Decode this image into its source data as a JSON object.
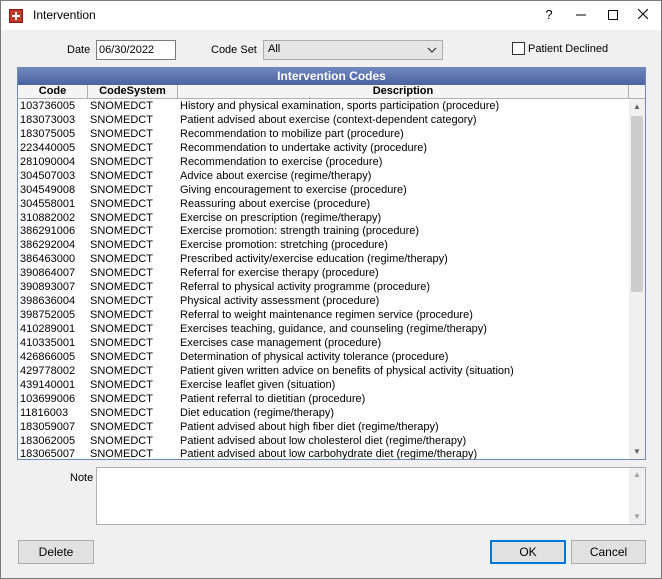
{
  "window": {
    "title": "Intervention"
  },
  "titlebar": {
    "help": "?",
    "minimize": "—",
    "maximize": "☐",
    "close": "✕"
  },
  "form": {
    "date_label": "Date",
    "date_value": "06/30/2022",
    "codeset_label": "Code Set",
    "codeset_value": "All",
    "declined_label": "Patient Declined",
    "declined_checked": false
  },
  "grid": {
    "title": "Intervention Codes",
    "columns": [
      "Code",
      "CodeSystem",
      "Description"
    ],
    "rows": [
      [
        "103736005",
        "SNOMEDCT",
        "History and physical examination, sports participation (procedure)"
      ],
      [
        "183073003",
        "SNOMEDCT",
        "Patient advised about exercise (context-dependent category)"
      ],
      [
        "183075005",
        "SNOMEDCT",
        "Recommendation to mobilize part (procedure)"
      ],
      [
        "223440005",
        "SNOMEDCT",
        "Recommendation to undertake activity (procedure)"
      ],
      [
        "281090004",
        "SNOMEDCT",
        "Recommendation to exercise (procedure)"
      ],
      [
        "304507003",
        "SNOMEDCT",
        "Advice about exercise (regime/therapy)"
      ],
      [
        "304549008",
        "SNOMEDCT",
        "Giving encouragement to exercise (procedure)"
      ],
      [
        "304558001",
        "SNOMEDCT",
        "Reassuring about exercise (procedure)"
      ],
      [
        "310882002",
        "SNOMEDCT",
        "Exercise on prescription (regime/therapy)"
      ],
      [
        "386291006",
        "SNOMEDCT",
        "Exercise promotion: strength training (procedure)"
      ],
      [
        "386292004",
        "SNOMEDCT",
        "Exercise promotion: stretching (procedure)"
      ],
      [
        "386463000",
        "SNOMEDCT",
        "Prescribed activity/exercise education (regime/therapy)"
      ],
      [
        "390864007",
        "SNOMEDCT",
        "Referral for exercise therapy (procedure)"
      ],
      [
        "390893007",
        "SNOMEDCT",
        "Referral to physical activity programme (procedure)"
      ],
      [
        "398636004",
        "SNOMEDCT",
        "Physical activity assessment (procedure)"
      ],
      [
        "398752005",
        "SNOMEDCT",
        "Referral to weight maintenance regimen service (procedure)"
      ],
      [
        "410289001",
        "SNOMEDCT",
        "Exercises teaching, guidance, and counseling (regime/therapy)"
      ],
      [
        "410335001",
        "SNOMEDCT",
        "Exercises case management (procedure)"
      ],
      [
        "426866005",
        "SNOMEDCT",
        "Determination of physical activity tolerance (procedure)"
      ],
      [
        "429778002",
        "SNOMEDCT",
        "Patient given written advice on benefits of physical activity (situation)"
      ],
      [
        "439140001",
        "SNOMEDCT",
        "Exercise leaflet given (situation)"
      ],
      [
        "103699006",
        "SNOMEDCT",
        "Patient referral to dietitian (procedure)"
      ],
      [
        "11816003",
        "SNOMEDCT",
        "Diet education (regime/therapy)"
      ],
      [
        "183059007",
        "SNOMEDCT",
        "Patient advised about high fiber diet (regime/therapy)"
      ],
      [
        "183062005",
        "SNOMEDCT",
        "Patient advised about low cholesterol diet (regime/therapy)"
      ],
      [
        "183065007",
        "SNOMEDCT",
        "Patient advised about low carbohydrate diet (regime/therapy)"
      ]
    ]
  },
  "note": {
    "label": "Note",
    "value": ""
  },
  "buttons": {
    "delete": "Delete",
    "ok": "OK",
    "cancel": "Cancel"
  },
  "colors": {
    "grid_title_bg": "#5a71b0",
    "accent": "#0078d7"
  }
}
